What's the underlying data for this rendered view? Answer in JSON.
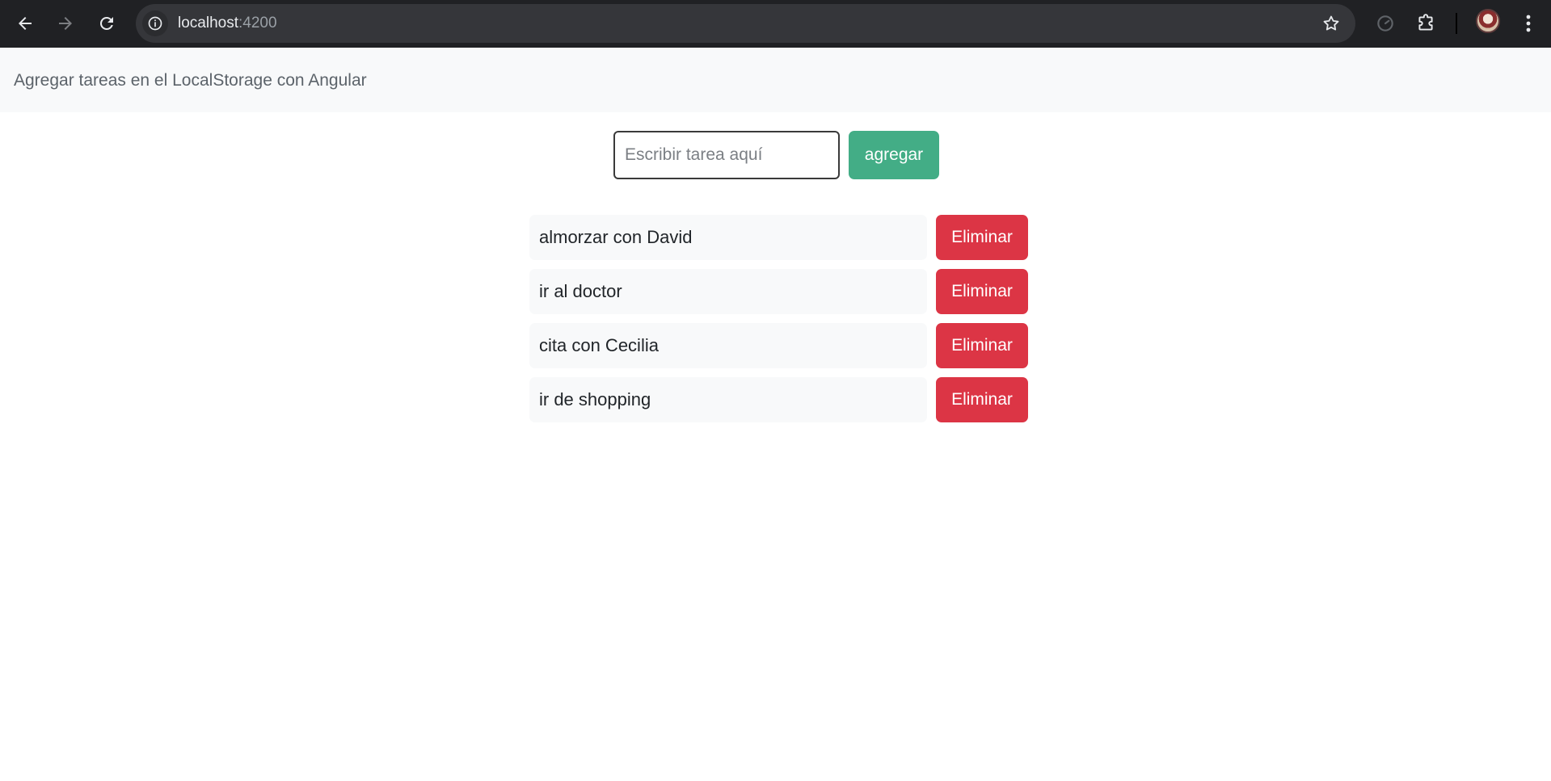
{
  "browser": {
    "url_host": "localhost",
    "url_port": ":4200"
  },
  "navbar": {
    "brand": "Agregar tareas en el LocalStorage con Angular"
  },
  "form": {
    "placeholder": "Escribir tarea aquí",
    "value": "",
    "add_label": "agregar"
  },
  "tasks": [
    {
      "text": "almorzar con David",
      "delete_label": "Eliminar"
    },
    {
      "text": "ir al doctor",
      "delete_label": "Eliminar"
    },
    {
      "text": "cita con Cecilia",
      "delete_label": "Eliminar"
    },
    {
      "text": "ir de shopping",
      "delete_label": "Eliminar"
    }
  ],
  "colors": {
    "chrome_bg": "#202124",
    "navbar_bg": "#f8f9fa",
    "add_button": "#43ad86",
    "delete_button": "#dc3545"
  },
  "icons": {
    "back": "arrow-left-icon",
    "forward": "arrow-right-icon",
    "reload": "reload-icon",
    "site_info": "info-icon",
    "bookmark": "star-icon",
    "performance": "speed-icon",
    "extensions": "puzzle-icon",
    "profile": "avatar",
    "menu": "kebab-menu-icon"
  }
}
